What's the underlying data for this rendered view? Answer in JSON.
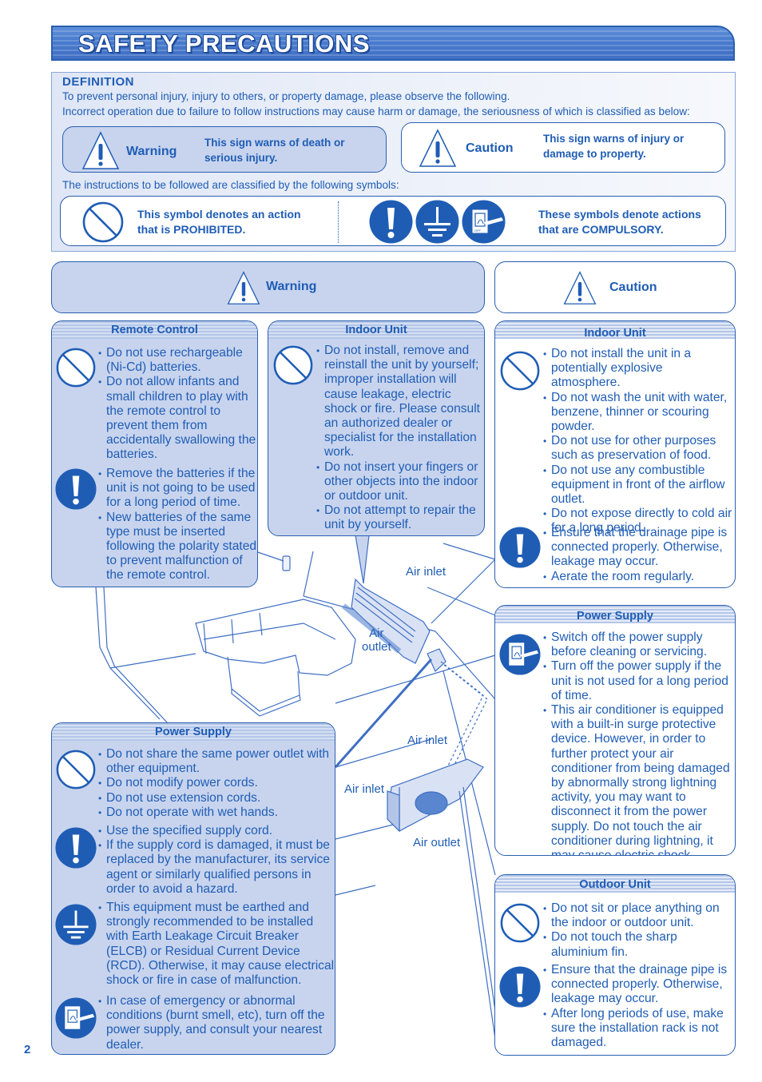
{
  "title": "SAFETY PRECAUTIONS",
  "definition": {
    "heading": "DEFINITION",
    "line1": "To prevent personal injury, injury to others, or property damage, please observe the following.",
    "line2": "Incorrect operation due to failure to follow instructions may cause harm or damage, the seriousness of which is classified as below:",
    "warning_sign": {
      "label": "Warning",
      "desc1": "This sign warns of death or",
      "desc2": "serious injury.",
      "icon": "warning-triangle-icon"
    },
    "caution_sign": {
      "label": "Caution",
      "desc1": "This sign warns of injury or",
      "desc2": "damage to property.",
      "icon": "warning-triangle-icon"
    },
    "symbols_intro": "The instructions to be followed are classified by the following symbols:",
    "prohibited": {
      "desc1": "This symbol denotes an action",
      "desc2": "that is PROHIBITED.",
      "icon": "prohibited-icon"
    },
    "compulsory": {
      "desc1": "These symbols denote actions",
      "desc2": "that are COMPULSORY.",
      "icons": [
        "exclamation-icon",
        "earth-ground-icon",
        "switch-off-icon"
      ]
    }
  },
  "warning_header": "Warning",
  "caution_header": "Caution",
  "cards": {
    "remote_control": {
      "title": "Remote Control",
      "prohibited": [
        "Do not use rechargeable (Ni-Cd) batteries.",
        "Do not allow infants and small children to play with the remote control to prevent them from accidentally swallowing the batteries."
      ],
      "compulsory": [
        "Remove the batteries if the unit is not going to be used for a long period of time.",
        "New batteries of the same type must be inserted following the polarity stated to prevent malfunction of the remote control."
      ]
    },
    "indoor_warning": {
      "title": "Indoor Unit",
      "prohibited": [
        "Do not install, remove and reinstall the unit by yourself; improper installation will cause leakage, electric shock or fire. Please consult an authorized dealer or specialist for the installation work.",
        "Do not insert your fingers or other objects into the indoor or outdoor unit.",
        "Do not attempt to repair the unit by yourself."
      ]
    },
    "indoor_caution": {
      "title": "Indoor Unit",
      "prohibited": [
        "Do not install the unit in a potentially explosive atmosphere.",
        "Do not wash the unit with water, benzene, thinner or scouring powder.",
        "Do not use for other purposes such as preservation of food.",
        "Do not use any combustible equipment in front of the airflow outlet.",
        "Do not expose directly to cold air for a long period."
      ],
      "compulsory": [
        "Ensure that the drainage pipe is connected properly. Otherwise, leakage may occur.",
        "Aerate the room regularly."
      ]
    },
    "power_caution": {
      "title": "Power Supply",
      "switch_off": [
        "Switch off the power supply before cleaning or servicing.",
        "Turn off the power supply if the unit is not used for a long period of time.",
        "This air conditioner is equipped with a built-in surge protective device. However, in order to further protect your air conditioner from being damaged by abnormally strong lightning activity, you may want to disconnect it from the power supply. Do not touch the air conditioner during lightning, it may cause electric shock."
      ]
    },
    "outdoor_caution": {
      "title": "Outdoor Unit",
      "prohibited": [
        "Do not sit or place anything on the indoor or outdoor unit.",
        "Do not touch the sharp aluminium fin."
      ],
      "compulsory": [
        "Ensure that the drainage pipe is connected properly. Otherwise, leakage may occur.",
        "After long periods of use, make sure the installation rack is not damaged."
      ]
    },
    "power_warning": {
      "title": "Power Supply",
      "prohibited": [
        "Do not share the same power outlet with other equipment.",
        "Do not modify power cords.",
        "Do not use extension cords.",
        "Do not operate with wet hands."
      ],
      "compulsory": [
        "Use the specified supply cord.",
        "If the supply cord is damaged, it must be replaced by the manufacturer, its service agent or similarly qualified persons in order to avoid a hazard."
      ],
      "earth": [
        "This equipment must be earthed and strongly recommended to be installed with Earth Leakage Circuit Breaker (ELCB) or Residual Current Device (RCD). Otherwise, it may cause electrical shock or fire in case of malfunction."
      ],
      "switch_off": [
        "In case of emergency or abnormal conditions (burnt smell, etc), turn off the power supply, and consult your nearest dealer."
      ]
    }
  },
  "illustration": {
    "indoor_air_inlet": "Air inlet",
    "indoor_air_outlet_1": "Air",
    "indoor_air_outlet_2": "outlet",
    "outdoor_air_inlet_top": "Air inlet",
    "outdoor_air_inlet_side": "Air inlet",
    "outdoor_air_outlet": "Air outlet"
  },
  "page_number": "2",
  "colors": {
    "primary": "#1f5db5",
    "warning_fill": "#c8d4ee",
    "border": "#2a5fb0"
  }
}
